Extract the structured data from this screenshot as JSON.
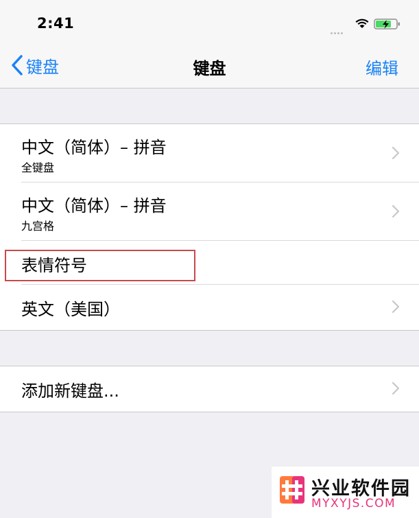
{
  "status_bar": {
    "time": "2:41"
  },
  "nav": {
    "back_label": "键盘",
    "title": "键盘",
    "edit_label": "编辑"
  },
  "keyboards": [
    {
      "title": "中文（简体）– 拼音",
      "subtitle": "全键盘"
    },
    {
      "title": "中文（简体）– 拼音",
      "subtitle": "九宫格"
    },
    {
      "title": "表情符号"
    },
    {
      "title": "英文（美国）"
    }
  ],
  "add_keyboard": {
    "label": "添加新键盘..."
  },
  "watermark": {
    "name": "兴业软件园",
    "url": "MYXYJS.COM"
  },
  "colors": {
    "accent": "#1a82f7",
    "highlight": "#c9484a",
    "watermark_pink": "#e8347a"
  }
}
